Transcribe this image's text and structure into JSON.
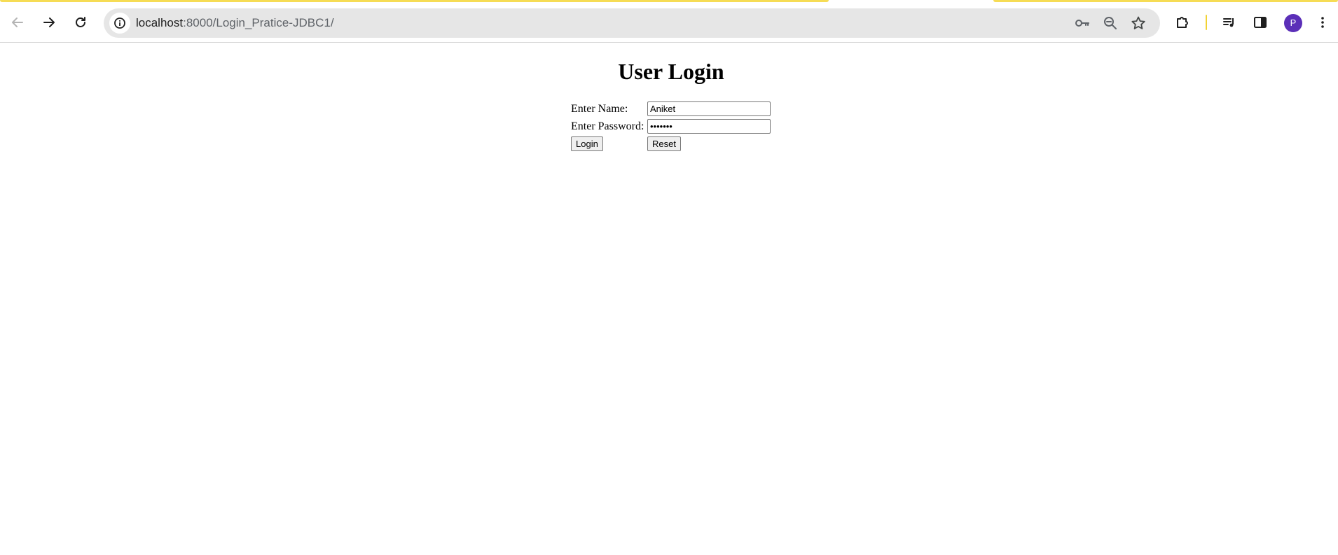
{
  "browser": {
    "url_host": "localhost",
    "url_path": ":8000/Login_Pratice-JDBC1/",
    "profile_initial": "P",
    "loading_bar_color": "#f6dc55",
    "icons": {
      "back": "arrow-left-icon",
      "forward": "arrow-right-icon",
      "reload": "reload-icon",
      "site_info": "info-icon",
      "passwords": "key-icon",
      "zoom": "zoom-out-icon",
      "bookmark": "star-icon",
      "extensions": "puzzle-icon",
      "media": "media-queue-icon",
      "side_panel": "side-panel-icon",
      "menu": "kebab-menu-icon"
    }
  },
  "page": {
    "title": "User Login",
    "form": {
      "name_label": "Enter Name:",
      "name_value": "Aniket",
      "password_label": "Enter Password:",
      "password_value": "aniket1",
      "login_label": "Login",
      "reset_label": "Reset"
    }
  }
}
